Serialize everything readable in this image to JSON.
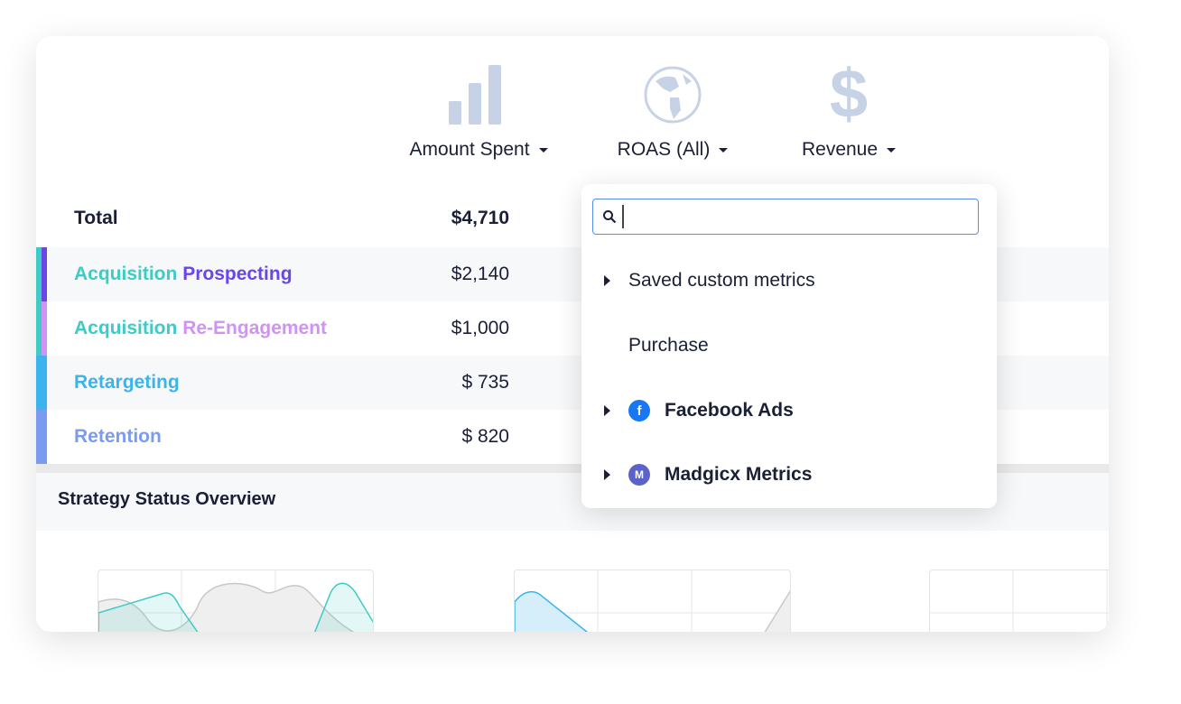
{
  "metrics": [
    {
      "label": "Amount Spent",
      "icon": "bar-chart-icon"
    },
    {
      "label": "ROAS (All)",
      "icon": "globe-icon"
    },
    {
      "label": "Revenue",
      "icon": "dollar-icon"
    }
  ],
  "total": {
    "label": "Total",
    "value": "$4,710"
  },
  "rows": [
    {
      "part1": "Acquisition",
      "part2": "Prospecting",
      "value": "$2,140"
    },
    {
      "part1": "Acquisition",
      "part2": "Re-Engagement",
      "value": "$1,000"
    },
    {
      "part1": "Retargeting",
      "part2": "",
      "value": "$ 735"
    },
    {
      "part1": "Retention",
      "part2": "",
      "value": "$ 820"
    }
  ],
  "section_title": "Strategy Status Overview",
  "dropdown": {
    "search_value": "",
    "items": [
      {
        "label": "Saved custom metrics"
      },
      {
        "label": "Purchase"
      },
      {
        "label": "Facebook Ads",
        "logo": "f"
      },
      {
        "label": "Madgicx Metrics",
        "logo": "M"
      }
    ]
  },
  "colors": {
    "teal": "#3ecbc3",
    "purple": "#6a45e8",
    "lilac": "#d093f4",
    "blue": "#3bb3ec",
    "periwinkle": "#7b9bf0",
    "icon": "#c8d2e6"
  }
}
